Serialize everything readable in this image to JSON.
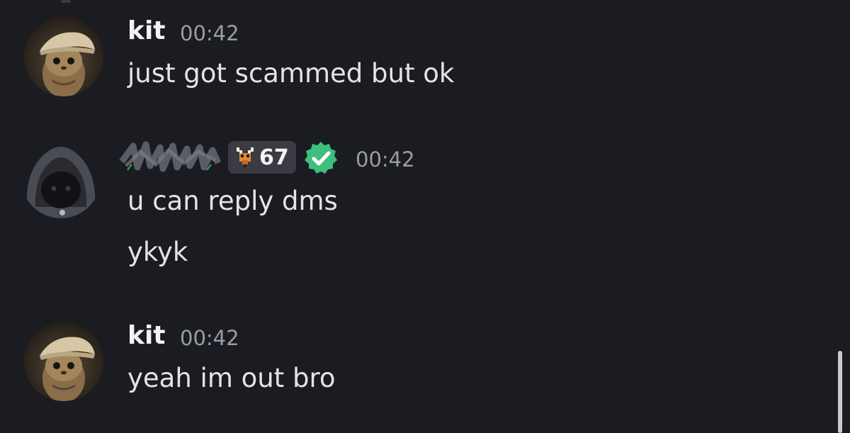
{
  "messages": [
    {
      "author": "kit",
      "time": "00:42",
      "lines": [
        "just got scammed but ok"
      ],
      "avatar_icon": "cat-with-cap-avatar"
    },
    {
      "author": "",
      "author_redacted": true,
      "level_badge": "67",
      "badge_icon": "pixel-deer-icon",
      "verified_icon": "verified-check-icon",
      "time": "00:42",
      "lines": [
        "u can reply dms",
        "ykyk"
      ],
      "avatar_icon": "hooded-cat-avatar"
    },
    {
      "author": "kit",
      "time": "00:42",
      "lines": [
        "yeah im out bro"
      ],
      "avatar_icon": "cat-with-cap-avatar"
    }
  ],
  "colors": {
    "background": "#1b1c21",
    "username": "#f2f3f5",
    "timestamp": "#9a9ca6",
    "message_text": "#e3e4e8",
    "verified_green": "#3fbf7f",
    "badge_bg": "#3a3b43"
  }
}
